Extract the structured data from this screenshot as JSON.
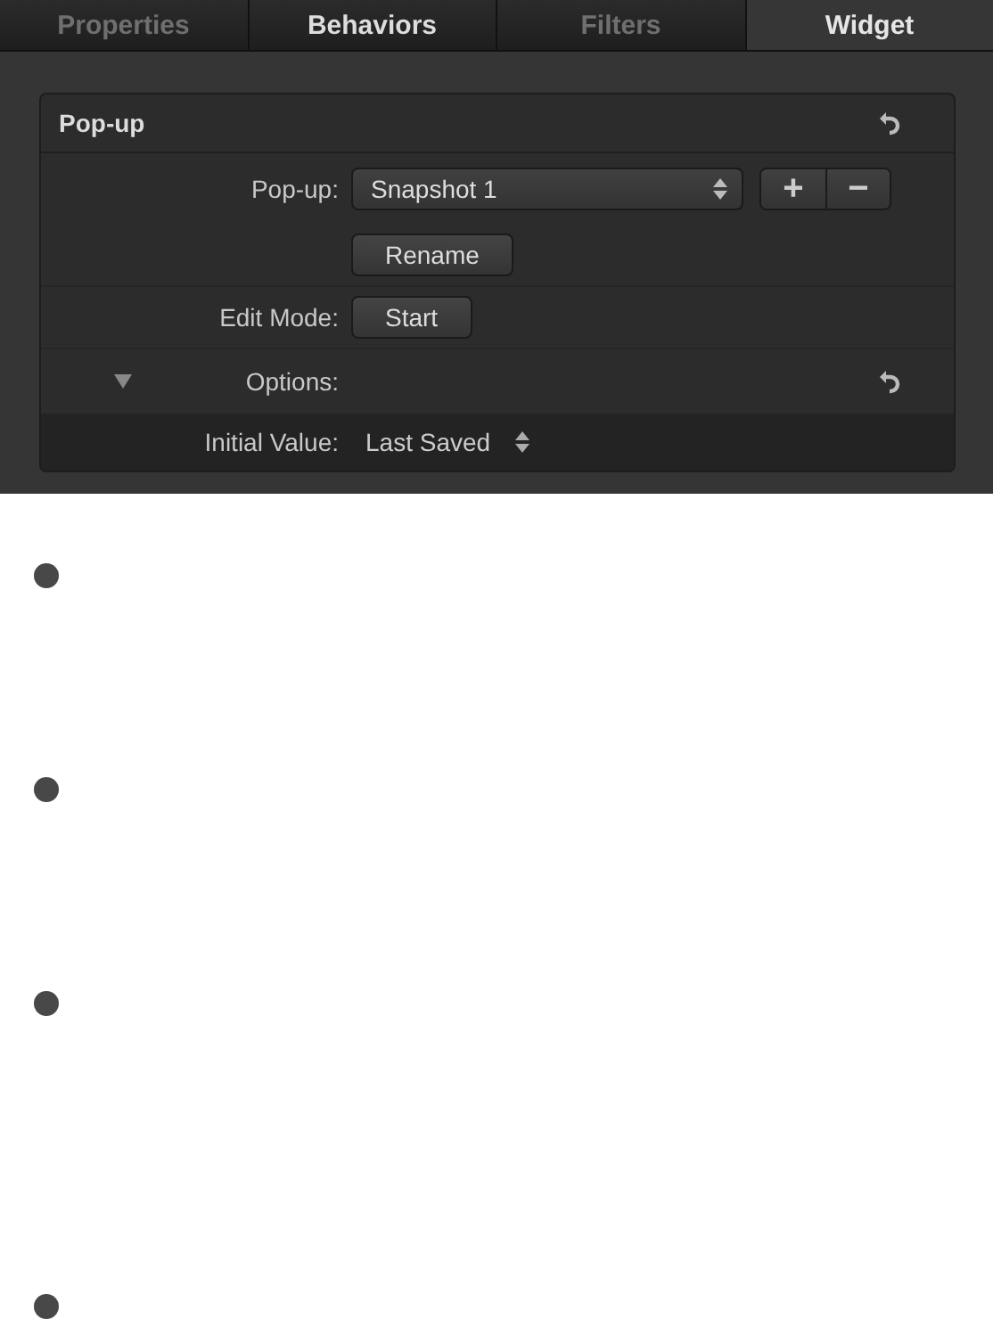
{
  "tabs": [
    {
      "label": "Properties",
      "selected": false,
      "dimmed": true
    },
    {
      "label": "Behaviors",
      "selected": false,
      "dimmed": false
    },
    {
      "label": "Filters",
      "selected": false,
      "dimmed": true
    },
    {
      "label": "Widget",
      "selected": true,
      "dimmed": false
    }
  ],
  "group": {
    "title": "Pop-up",
    "rows": [
      {
        "kind": "popup",
        "label": "Pop-up:",
        "value": "Snapshot 1",
        "add": "+",
        "remove": "−"
      },
      {
        "kind": "button",
        "button": "Rename"
      },
      {
        "kind": "button",
        "label": "Edit Mode:",
        "button": "Start"
      },
      {
        "kind": "disclosure",
        "label": "Options:",
        "expanded": true
      },
      {
        "kind": "stepper",
        "label": "Initial Value:",
        "value": "Last Saved"
      }
    ]
  },
  "bullets": [
    {
      "kind": "dot"
    },
    {
      "kind": "dot"
    },
    {
      "kind": "dot"
    },
    {
      "kind": "dot"
    }
  ]
}
